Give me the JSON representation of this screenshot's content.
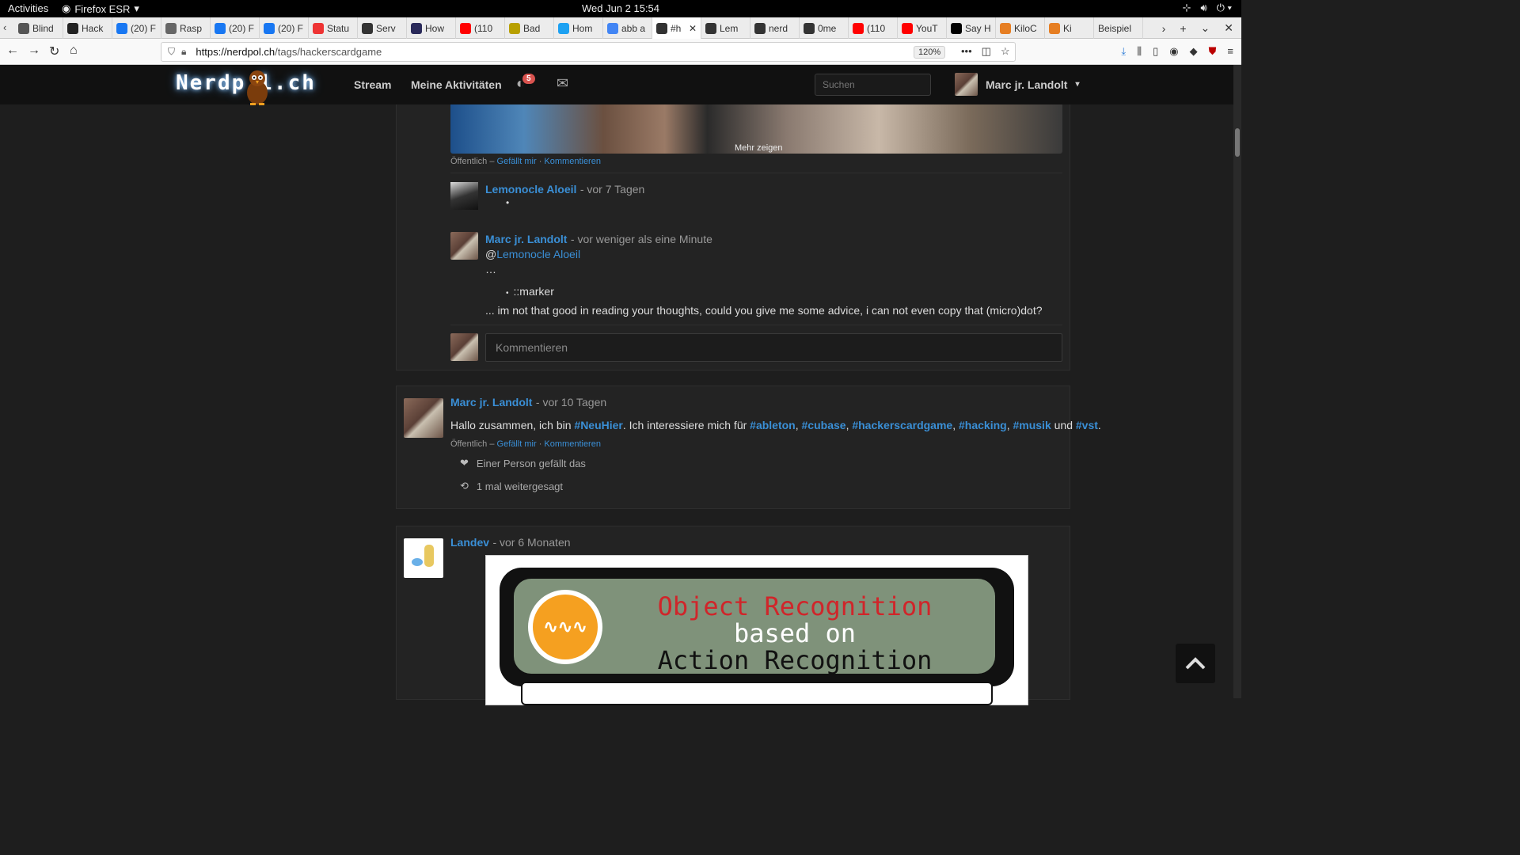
{
  "gnome": {
    "activities": "Activities",
    "app": "Firefox ESR",
    "clock": "Wed Jun 2  15:54"
  },
  "tabs": [
    {
      "label": "Blind",
      "icon": "page-icon",
      "color": "#555"
    },
    {
      "label": "Hack",
      "icon": "hack-icon",
      "color": "#222"
    },
    {
      "label": "(20) F",
      "icon": "facebook-icon",
      "color": "#1877f2"
    },
    {
      "label": "Rasp",
      "icon": "at-icon",
      "color": "#666"
    },
    {
      "label": "(20) F",
      "icon": "facebook-icon",
      "color": "#1877f2"
    },
    {
      "label": "(20) F",
      "icon": "facebook-icon",
      "color": "#1877f2"
    },
    {
      "label": "Statu",
      "icon": "status-icon",
      "color": "#e33"
    },
    {
      "label": "Serv",
      "icon": "warning-icon",
      "color": "#333"
    },
    {
      "label": "How",
      "icon": "globe-icon",
      "color": "#2a2a5a"
    },
    {
      "label": "(110",
      "icon": "youtube-icon",
      "color": "#f00"
    },
    {
      "label": "Bad",
      "icon": "bad-icon",
      "color": "#b8a000"
    },
    {
      "label": "Hom",
      "icon": "twitter-icon",
      "color": "#1da1f2"
    },
    {
      "label": "abb a",
      "icon": "google-icon",
      "color": "#4285f4"
    },
    {
      "label": "#h",
      "icon": "diaspora-icon",
      "color": "#333"
    },
    {
      "label": "Lem",
      "icon": "diaspora-icon",
      "color": "#333"
    },
    {
      "label": "nerd",
      "icon": "diaspora-icon",
      "color": "#333"
    },
    {
      "label": "0me",
      "icon": "diaspora-icon",
      "color": "#333"
    },
    {
      "label": "(110",
      "icon": "youtube-icon",
      "color": "#f00"
    },
    {
      "label": "YouT",
      "icon": "youtube-icon",
      "color": "#f00"
    },
    {
      "label": "Say H",
      "icon": "tw-icon",
      "color": "#000"
    },
    {
      "label": "KiloC",
      "icon": "kilo-icon",
      "color": "#e67e22"
    },
    {
      "label": "Ki",
      "icon": "kilo-icon",
      "color": "#e67e22"
    },
    {
      "label": "Beispiel",
      "icon": "",
      "color": "#ccc"
    }
  ],
  "navbar": {
    "url_host": "https://nerdpol.ch",
    "url_path": "/tags/hackerscardgame",
    "zoom": "120%"
  },
  "site": {
    "logo_left": "Nerdp",
    "logo_right": "l.ch",
    "menu_stream": "Stream",
    "menu_activity": "Meine Aktivitäten",
    "notif_count": "5",
    "search_placeholder": "Suchen",
    "user_name": "Marc jr. Landolt"
  },
  "post1": {
    "show_more": "Mehr zeigen",
    "visibility": "Öffentlich",
    "like": "Gefällt mir",
    "comment": "Kommentieren",
    "comments": [
      {
        "author": "Lemonocle Aloeil",
        "time": "- vor 7 Tagen",
        "bullet": "•"
      },
      {
        "author": "Marc jr. Landolt",
        "time": "- vor weniger als eine Minute",
        "mention_prefix": "@",
        "mention": "Lemonocle Aloeil",
        "ellipsis": "…",
        "marker": "::marker",
        "text": "... im not that good in reading your thoughts, could you give me some advice, i can not even copy that (micro)dot?"
      }
    ],
    "comment_placeholder": "Kommentieren"
  },
  "post2": {
    "author": "Marc jr. Landolt",
    "time": "- vor 10 Tagen",
    "text_intro": "Hallo zusammen, ich bin ",
    "tag_neuhier": "#NeuHier",
    "text_mid": ". Ich interessiere mich für ",
    "tags": [
      "#ableton",
      "#cubase",
      "#hackerscardgame",
      "#hacking",
      "#musik"
    ],
    "sep": ", ",
    "text_und": " und ",
    "tag_last": "#vst",
    "text_end": ".",
    "visibility": "Öffentlich",
    "like": "Gefällt mir",
    "comment": "Kommentieren",
    "likes_text": "Einer Person gefällt das",
    "reshares_text": "1 mal weitergesagt"
  },
  "post3": {
    "author": "Landev",
    "time": "- vor 6 Monaten",
    "image_title_1": "Object Recognition",
    "image_title_2": "based on",
    "image_title_3": "Action Recognition"
  }
}
